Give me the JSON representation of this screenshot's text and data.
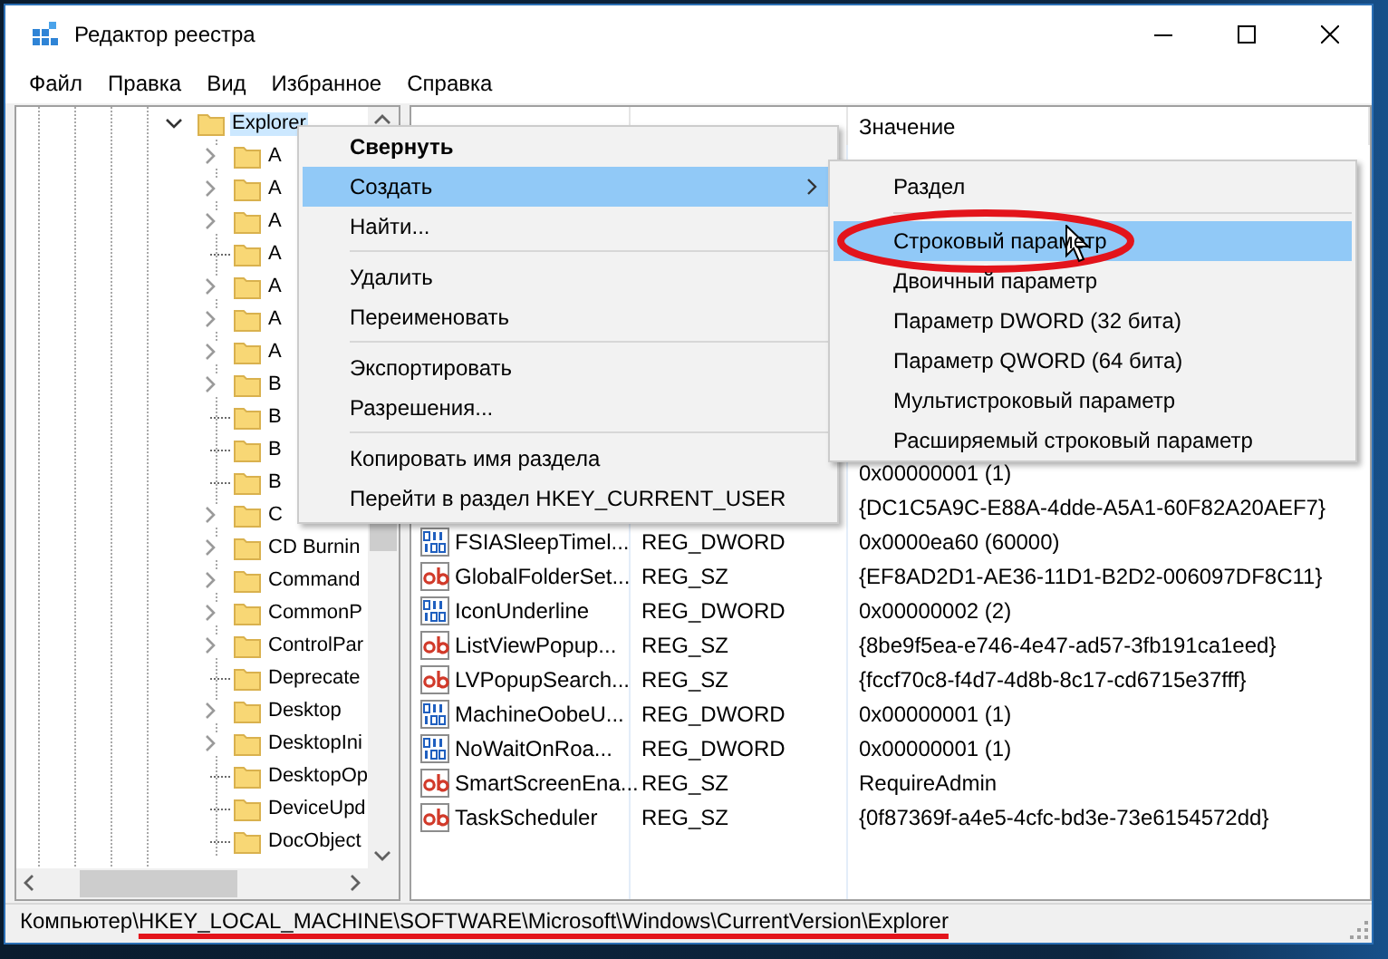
{
  "window": {
    "title": "Редактор реестра"
  },
  "menu_bar": [
    {
      "label": "Файл"
    },
    {
      "label": "Правка"
    },
    {
      "label": "Вид"
    },
    {
      "label": "Избранное"
    },
    {
      "label": "Справка"
    }
  ],
  "tree": {
    "items": [
      {
        "label": "Explorer",
        "has_children": true,
        "expanded": true,
        "selected": true,
        "children": [
          {
            "label": "A",
            "has_children": true,
            "expanded": false,
            "selected": false
          },
          {
            "label": "A",
            "has_children": true,
            "expanded": false,
            "selected": false
          },
          {
            "label": "A",
            "has_children": true,
            "expanded": false,
            "selected": false
          },
          {
            "label": "A",
            "has_children": false,
            "selected": false
          },
          {
            "label": "A",
            "has_children": true,
            "expanded": false,
            "selected": false
          },
          {
            "label": "A",
            "has_children": true,
            "expanded": false,
            "selected": false
          },
          {
            "label": "A",
            "has_children": true,
            "expanded": false,
            "selected": false
          },
          {
            "label": "B",
            "has_children": true,
            "expanded": false,
            "selected": false
          },
          {
            "label": "B",
            "has_children": false,
            "selected": false
          },
          {
            "label": "B",
            "has_children": false,
            "selected": false
          },
          {
            "label": "B",
            "has_children": false,
            "selected": false
          },
          {
            "label": "C",
            "has_children": true,
            "expanded": false,
            "selected": false
          },
          {
            "label": "CD Burnin",
            "has_children": true,
            "expanded": false,
            "selected": false
          },
          {
            "label": "Command",
            "has_children": true,
            "expanded": false,
            "selected": false
          },
          {
            "label": "CommonP",
            "has_children": true,
            "expanded": false,
            "selected": false
          },
          {
            "label": "ControlPar",
            "has_children": true,
            "expanded": false,
            "selected": false
          },
          {
            "label": "Deprecate",
            "has_children": false,
            "selected": false
          },
          {
            "label": "Desktop",
            "has_children": true,
            "expanded": false,
            "selected": false
          },
          {
            "label": "DesktopIni",
            "has_children": true,
            "expanded": false,
            "selected": false
          },
          {
            "label": "DesktopOp",
            "has_children": false,
            "selected": false
          },
          {
            "label": "DeviceUpd",
            "has_children": false,
            "selected": false
          },
          {
            "label": "DocObject",
            "has_children": false,
            "selected": false
          }
        ]
      }
    ]
  },
  "values": {
    "value_header": "Значение",
    "rows": [
      {
        "value": "0x00000001 (1)"
      },
      {
        "value": "{DC1C5A9C-E88A-4dde-A5A1-60F82A20AEF7}"
      },
      {
        "kind": "dword",
        "name": "FSIASleepTimel...",
        "type": "REG_DWORD",
        "value": "0x0000ea60 (60000)"
      },
      {
        "kind": "sz",
        "name": "GlobalFolderSet...",
        "type": "REG_SZ",
        "value": "{EF8AD2D1-AE36-11D1-B2D2-006097DF8C11}"
      },
      {
        "kind": "dword",
        "name": "IconUnderline",
        "type": "REG_DWORD",
        "value": "0x00000002 (2)"
      },
      {
        "kind": "sz",
        "name": "ListViewPopup...",
        "type": "REG_SZ",
        "value": "{8be9f5ea-e746-4e47-ad57-3fb191ca1eed}"
      },
      {
        "kind": "sz",
        "name": "LVPopupSearch...",
        "type": "REG_SZ",
        "value": "{fccf70c8-f4d7-4d8b-8c17-cd6715e37fff}"
      },
      {
        "kind": "dword",
        "name": "MachineOobeU...",
        "type": "REG_DWORD",
        "value": "0x00000001 (1)"
      },
      {
        "kind": "dword",
        "name": "NoWaitOnRoa...",
        "type": "REG_DWORD",
        "value": "0x00000001 (1)"
      },
      {
        "kind": "sz",
        "name": "SmartScreenEna...",
        "type": "REG_SZ",
        "value": "RequireAdmin"
      },
      {
        "kind": "sz",
        "name": "TaskScheduler",
        "type": "REG_SZ",
        "value": "{0f87369f-a4e5-4cfc-bd3e-73e6154572dd}"
      }
    ]
  },
  "context_menu": {
    "items": [
      {
        "kind": "item",
        "label": "Свернуть",
        "bold": true,
        "selected": false,
        "submenu": false
      },
      {
        "kind": "item",
        "label": "Создать",
        "bold": false,
        "selected": true,
        "submenu": true
      },
      {
        "kind": "item",
        "label": "Найти...",
        "bold": false,
        "selected": false,
        "submenu": false
      },
      {
        "kind": "separator"
      },
      {
        "kind": "item",
        "label": "Удалить",
        "bold": false,
        "selected": false,
        "submenu": false
      },
      {
        "kind": "item",
        "label": "Переименовать",
        "bold": false,
        "selected": false,
        "submenu": false
      },
      {
        "kind": "separator"
      },
      {
        "kind": "item",
        "label": "Экспортировать",
        "bold": false,
        "selected": false,
        "submenu": false
      },
      {
        "kind": "item",
        "label": "Разрешения...",
        "bold": false,
        "selected": false,
        "submenu": false
      },
      {
        "kind": "separator"
      },
      {
        "kind": "item",
        "label": "Копировать имя раздела",
        "bold": false,
        "selected": false,
        "submenu": false
      },
      {
        "kind": "item",
        "label": "Перейти в раздел HKEY_CURRENT_USER",
        "bold": false,
        "selected": false,
        "submenu": false
      }
    ]
  },
  "submenu": {
    "items": [
      {
        "kind": "item",
        "label": "Раздел",
        "selected": false,
        "circled": false
      },
      {
        "kind": "separator"
      },
      {
        "kind": "item",
        "label": "Строковый параметр",
        "selected": true,
        "circled": true
      },
      {
        "kind": "item",
        "label": "Двоичный параметр",
        "selected": false,
        "circled": false
      },
      {
        "kind": "item",
        "label": "Параметр DWORD (32 бита)",
        "selected": false,
        "circled": false
      },
      {
        "kind": "item",
        "label": "Параметр QWORD (64 бита)",
        "selected": false,
        "circled": false
      },
      {
        "kind": "item",
        "label": "Мультистроковый параметр",
        "selected": false,
        "circled": false
      },
      {
        "kind": "item",
        "label": "Расширяемый строковый параметр",
        "selected": false,
        "circled": false
      }
    ]
  },
  "status_bar": {
    "path_prefix": "Компьютер\\",
    "path": "HKEY_LOCAL_MACHINE\\SOFTWARE\\Microsoft\\Windows\\CurrentVersion\\Explorer",
    "underlined": true
  }
}
